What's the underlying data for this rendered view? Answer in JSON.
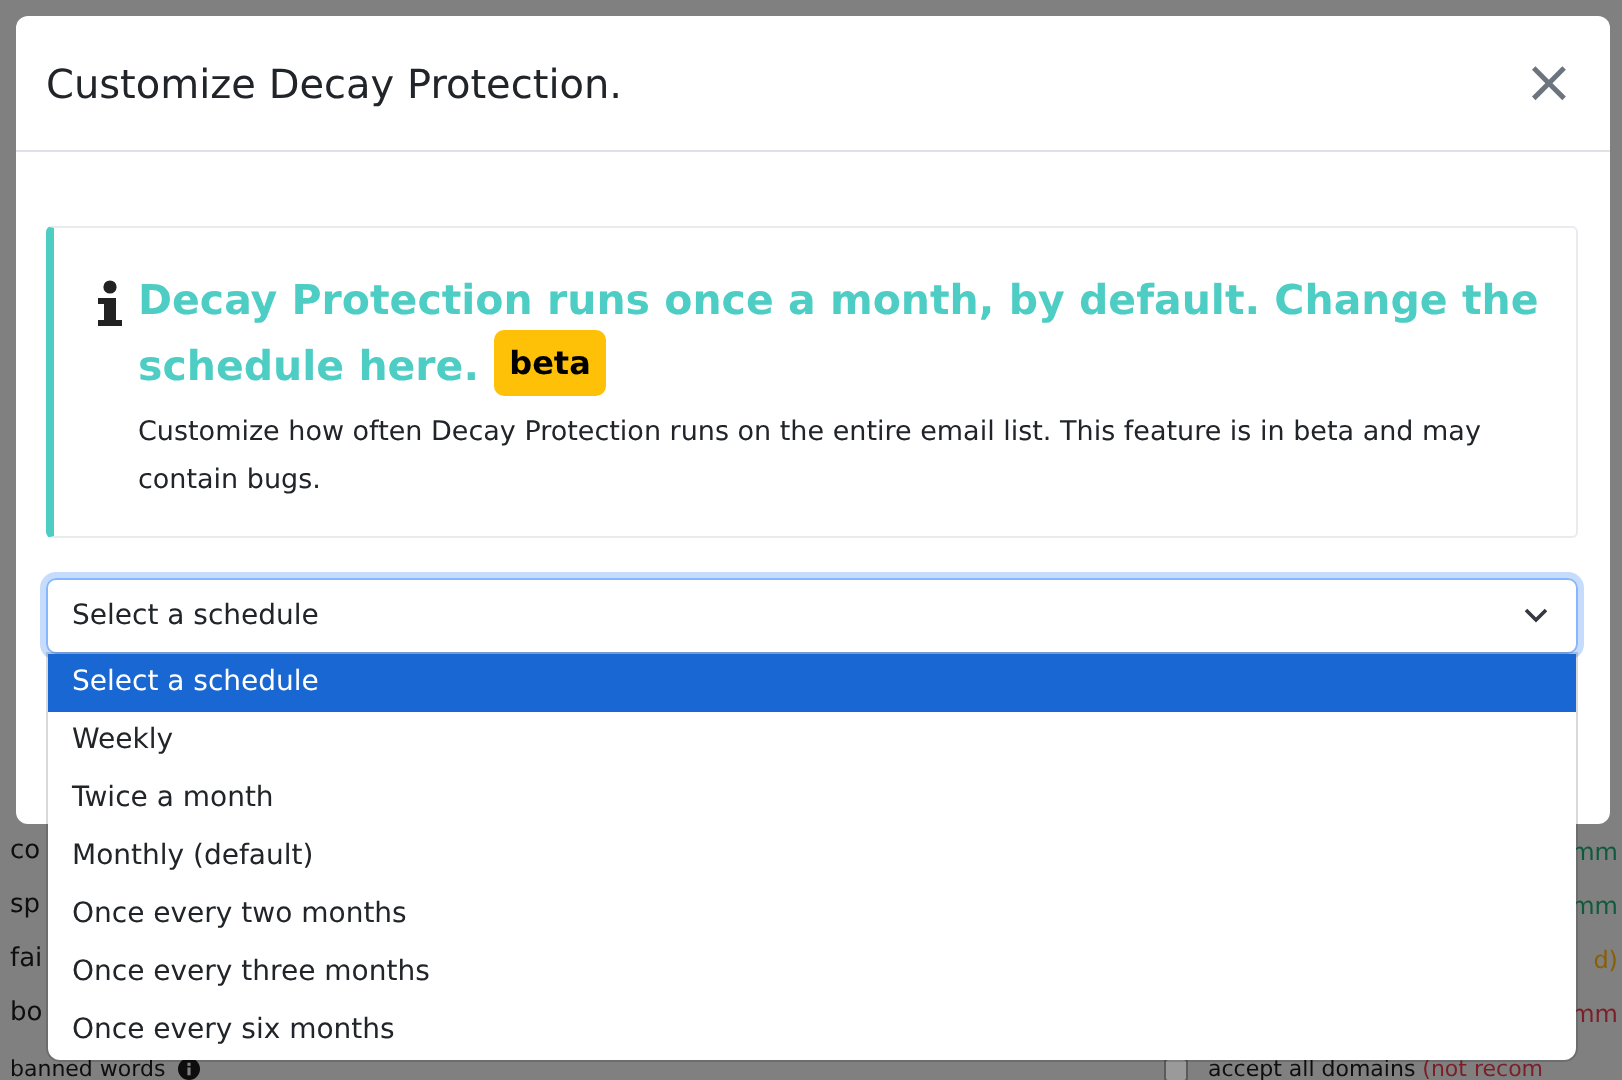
{
  "background": {
    "rows": [
      {
        "left": "co",
        "right": "mm",
        "color": "#0f5a3c"
      },
      {
        "left": "sp",
        "right": "mm",
        "color": "#0f5a3c"
      },
      {
        "left": "fai",
        "right": "d)",
        "color": "#8a5f00"
      },
      {
        "left": "bo",
        "right": "mm",
        "color": "#7a1f28"
      }
    ],
    "last_row": {
      "label": "banned words",
      "info": true,
      "option": {
        "label": "accept all domains",
        "note": "(not recom",
        "checked": false
      }
    }
  },
  "modal": {
    "title": "Customize Decay Protection.",
    "close": "×",
    "alert": {
      "heading": "**Decay Protection runs once a month, by default.** Change the schedule here.",
      "badge": "beta",
      "text": "Customize how often Decay Protection runs on the entire email list. This feature is in beta and may contain bugs."
    },
    "select": {
      "value": "Select a schedule",
      "open": true,
      "options": [
        {
          "label": "Select a schedule",
          "selected": true
        },
        {
          "label": "Weekly",
          "selected": false
        },
        {
          "label": "Twice a month",
          "selected": false
        },
        {
          "label": "Monthly (default)",
          "selected": false
        },
        {
          "label": "Once every two months",
          "selected": false
        },
        {
          "label": "Once every three months",
          "selected": false
        },
        {
          "label": "Once every six months",
          "selected": false
        }
      ]
    }
  }
}
